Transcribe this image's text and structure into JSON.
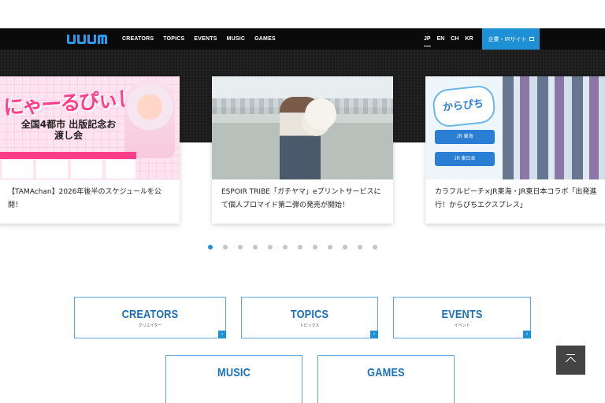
{
  "header": {
    "logo_text": "UUUM",
    "nav": [
      "CREATORS",
      "TOPICS",
      "EVENTS",
      "MUSIC",
      "GAMES"
    ],
    "languages": [
      "JP",
      "EN",
      "CH",
      "KR"
    ],
    "active_language": "JP",
    "corporate_button": "企業・IRサイト",
    "accent_color": "#1e90d6"
  },
  "slides": [
    {
      "art_title": "にゃーるぴぃじっ！",
      "art_subtitle": "全国4都市 出版記念お渡し会",
      "text": "【TAMAchan】2026年後半のスケジュールを公開！"
    },
    {
      "text": "ESPOIR TRIBE「ガチヤマ」eプリントサービスにて個人ブロマイド第二弾の発売が開始！"
    },
    {
      "art_title": "からぴち",
      "art_box1": "JR 東海",
      "art_box2": "JR 東日本",
      "text": "カラフルピーチ×JR東海・JR東日本コラボ「出発進行！からぴちエクスプレス」"
    }
  ],
  "pagination": {
    "count": 12,
    "active_index": 0
  },
  "categories": [
    {
      "title": "CREATORS",
      "subtitle": "クリエイター"
    },
    {
      "title": "TOPICS",
      "subtitle": "トピックス"
    },
    {
      "title": "EVENTS",
      "subtitle": "イベント"
    },
    {
      "title": "MUSIC",
      "subtitle": ""
    },
    {
      "title": "GAMES",
      "subtitle": ""
    }
  ]
}
